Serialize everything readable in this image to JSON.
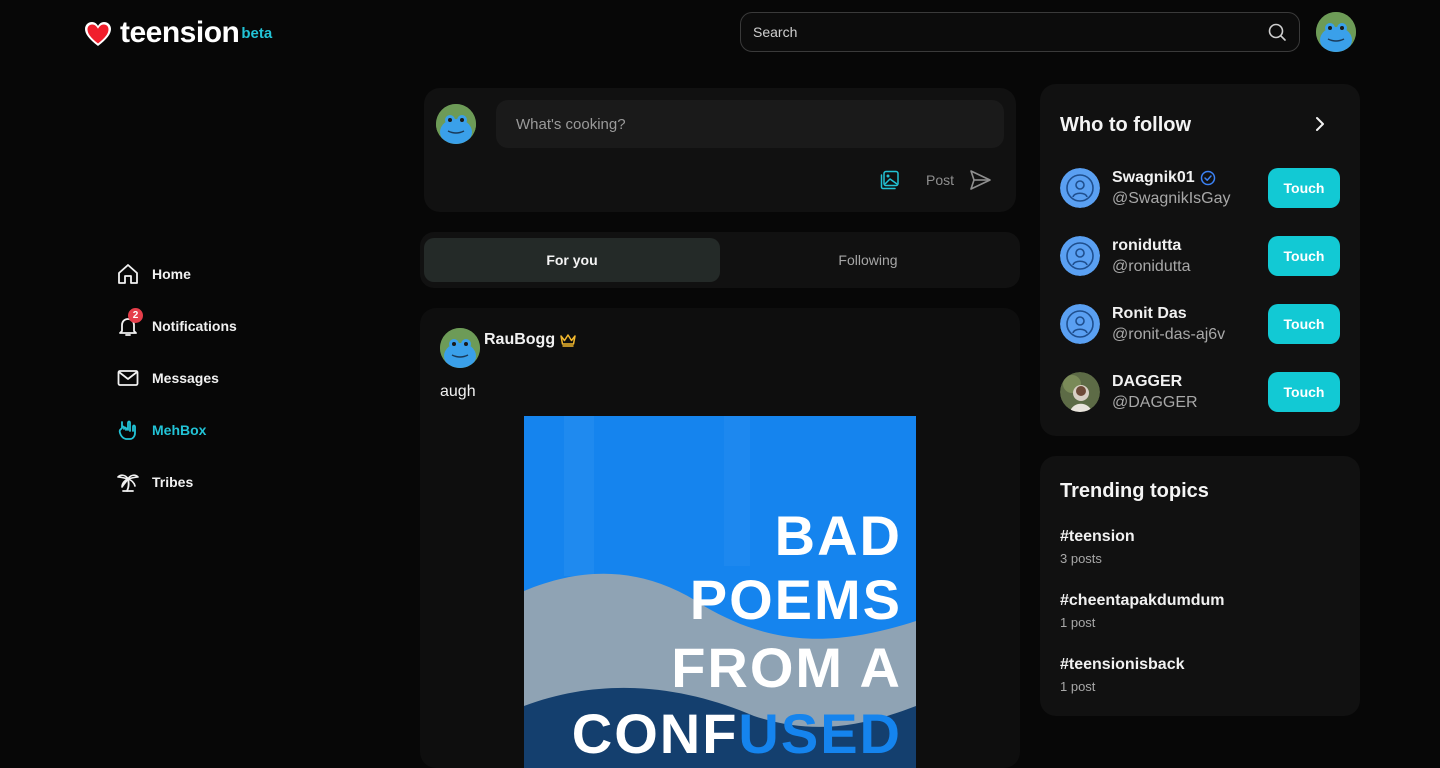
{
  "brand": {
    "name": "teension",
    "badge": "beta",
    "accent": "#22c3d6",
    "heart_color": "#f01e2c"
  },
  "search": {
    "placeholder": "Search"
  },
  "nav": {
    "items": [
      {
        "label": "Home",
        "icon": "home-icon"
      },
      {
        "label": "Notifications",
        "icon": "bell-icon",
        "badge": "2"
      },
      {
        "label": "Messages",
        "icon": "mail-icon"
      },
      {
        "label": "MehBox",
        "icon": "rock-hand-icon",
        "active": true
      },
      {
        "label": "Tribes",
        "icon": "palm-tree-icon"
      }
    ]
  },
  "composer": {
    "placeholder": "What's cooking?",
    "post_label": "Post"
  },
  "tabs": [
    {
      "label": "For you",
      "active": true
    },
    {
      "label": "Following",
      "active": false
    }
  ],
  "post": {
    "author": "RauBogg",
    "text": "augh",
    "image_lines": [
      "BAD",
      "POEMS",
      "FROM A",
      "CONFUSED"
    ]
  },
  "who_to_follow": {
    "title": "Who to follow",
    "button_label": "Touch",
    "users": [
      {
        "name": "Swagnik01",
        "handle": "@SwagnikIsGay",
        "verified": true
      },
      {
        "name": "ronidutta",
        "handle": "@ronidutta"
      },
      {
        "name": "Ronit Das",
        "handle": "@ronit-das-aj6v"
      },
      {
        "name": "DAGGER",
        "handle": "@DAGGER"
      }
    ]
  },
  "trending": {
    "title": "Trending topics",
    "topics": [
      {
        "tag": "#teension",
        "count": "3 posts"
      },
      {
        "tag": "#cheentapakdumdum",
        "count": "1 post"
      },
      {
        "tag": "#teensionisback",
        "count": "1 post"
      }
    ]
  }
}
